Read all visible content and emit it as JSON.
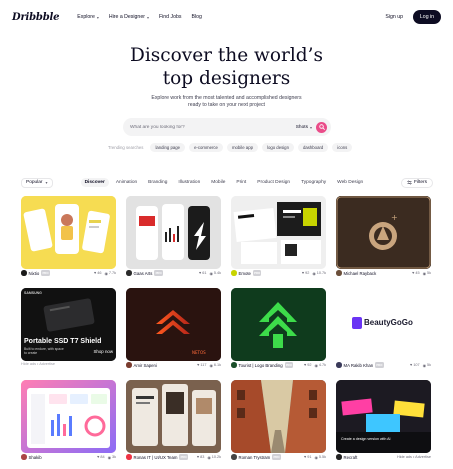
{
  "nav": {
    "logo": "Dribbble",
    "links": [
      {
        "label": "Explore",
        "dropdown": true
      },
      {
        "label": "Hire a Designer",
        "dropdown": true
      },
      {
        "label": "Find Jobs",
        "dropdown": false
      },
      {
        "label": "Blog",
        "dropdown": false
      }
    ],
    "signup": "Sign up",
    "login": "Log in"
  },
  "hero": {
    "title_line1": "Discover the world’s",
    "title_line2": "top designers",
    "sub_line1": "Explore work from the most talented and accomplished designers",
    "sub_line2": "ready to take on your next project"
  },
  "search": {
    "placeholder": "What are you looking for?",
    "type": "Shots",
    "icon": "search-icon",
    "accent": "#ea4c89"
  },
  "trending": {
    "label": "Trending searches",
    "items": [
      "landing page",
      "e-commerce",
      "mobile app",
      "logo design",
      "dashboard",
      "icons"
    ]
  },
  "filters": {
    "sort": "Popular",
    "categories": [
      "Discover",
      "Animation",
      "Branding",
      "Illustration",
      "Mobile",
      "Print",
      "Product Design",
      "Typography",
      "Web Design"
    ],
    "active": "Discover",
    "filter_label": "Filters"
  },
  "shots": [
    {
      "author": "Nixtio",
      "badge": "PRO",
      "likes": "46",
      "views": "7.7k",
      "avatar_color": "#1a1a1a",
      "kind": "phone-yellow"
    },
    {
      "author": "Gaas Arts",
      "badge": "PRO",
      "likes": "61",
      "views": "5.4k",
      "avatar_color": "#2b2b2b",
      "kind": "phones-red"
    },
    {
      "author": "Emote",
      "badge": "PRO",
      "likes": "92",
      "views": "10.7k",
      "avatar_color": "#c8d400",
      "kind": "web-dark"
    },
    {
      "author": "Michael Rayback",
      "badge": "",
      "likes": "45",
      "views": "5k",
      "avatar_color": "#6b4f3a",
      "kind": "logo-brown"
    },
    {
      "author": "Samsung Portable SSD",
      "badge": "",
      "likes": "",
      "views": "",
      "avatar_color": "#000000",
      "kind": "ad-ssd",
      "ad_text": "Hide ads • Advertise",
      "ad_title": "Portable SSD T7 Shield",
      "ad_subtitle": "Built to endure, with space to create",
      "ad_cta": "Shop now",
      "ad_brand": "SAMSUNG"
    },
    {
      "author": "Amir Sapeni",
      "badge": "",
      "likes": "117",
      "views": "6.1k",
      "avatar_color": "#7a3b2e",
      "kind": "logo-orange"
    },
    {
      "author": "Tourist | Logo Branding",
      "badge": "PRO",
      "likes": "92",
      "views": "4.7k",
      "avatar_color": "#1a4f2a",
      "kind": "logo-green"
    },
    {
      "author": "MA Rakib Khan",
      "badge": "PRO",
      "likes": "107",
      "views": "5k",
      "avatar_color": "#3a3a5a",
      "kind": "logo-beauty",
      "brand_text": "BeautyGoGo"
    },
    {
      "author": "Shakib",
      "badge": "",
      "likes": "84",
      "views": "3k",
      "avatar_color": "#a44",
      "kind": "dashboard"
    },
    {
      "author": "Ronas IT | UI/UX Team",
      "badge": "PRO",
      "likes": "83",
      "views": "10.2k",
      "avatar_color": "#e34",
      "kind": "book-brown"
    },
    {
      "author": "Roman Trystram",
      "badge": "PRO",
      "likes": "91",
      "views": "5.5k",
      "avatar_color": "#444",
      "kind": "street-art"
    },
    {
      "author": "Recraft",
      "badge": "",
      "likes": "",
      "views": "",
      "avatar_color": "#222",
      "kind": "ad-recraft",
      "ad_text": "Hide ads • Advertise",
      "ad_title": "Create a design version with AI"
    }
  ]
}
